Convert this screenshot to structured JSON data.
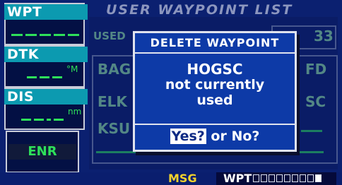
{
  "left_panel": {
    "wpt_label": "WPT",
    "dtk_label": "DTK",
    "dtk_unit": "°M",
    "dis_label": "DIS",
    "dis_unit": "nm",
    "mode": "ENR"
  },
  "page": {
    "title": "USER WAYPOINT LIST",
    "used_label": "USED",
    "used_count": "33",
    "rows": [
      "BAG",
      "ELK",
      "KSU"
    ],
    "right_col": [
      "FD",
      "SC"
    ]
  },
  "dialog": {
    "title": "DELETE WAYPOINT",
    "waypoint_name": "HOGSC",
    "message_line1": "not currently",
    "message_line2": "used",
    "yes_label": "Yes?",
    "or_no_label": " or No?"
  },
  "status_bar": {
    "msg": "MSG",
    "page_group": "WPT",
    "page_count": 9,
    "active_page": 9
  },
  "colors": {
    "background": "#0b2070",
    "label_cyan": "#0c9ab0",
    "green_text": "#2ee05a",
    "dialog_blue": "#0d3aa7",
    "msg_yellow": "#f2d22c"
  }
}
